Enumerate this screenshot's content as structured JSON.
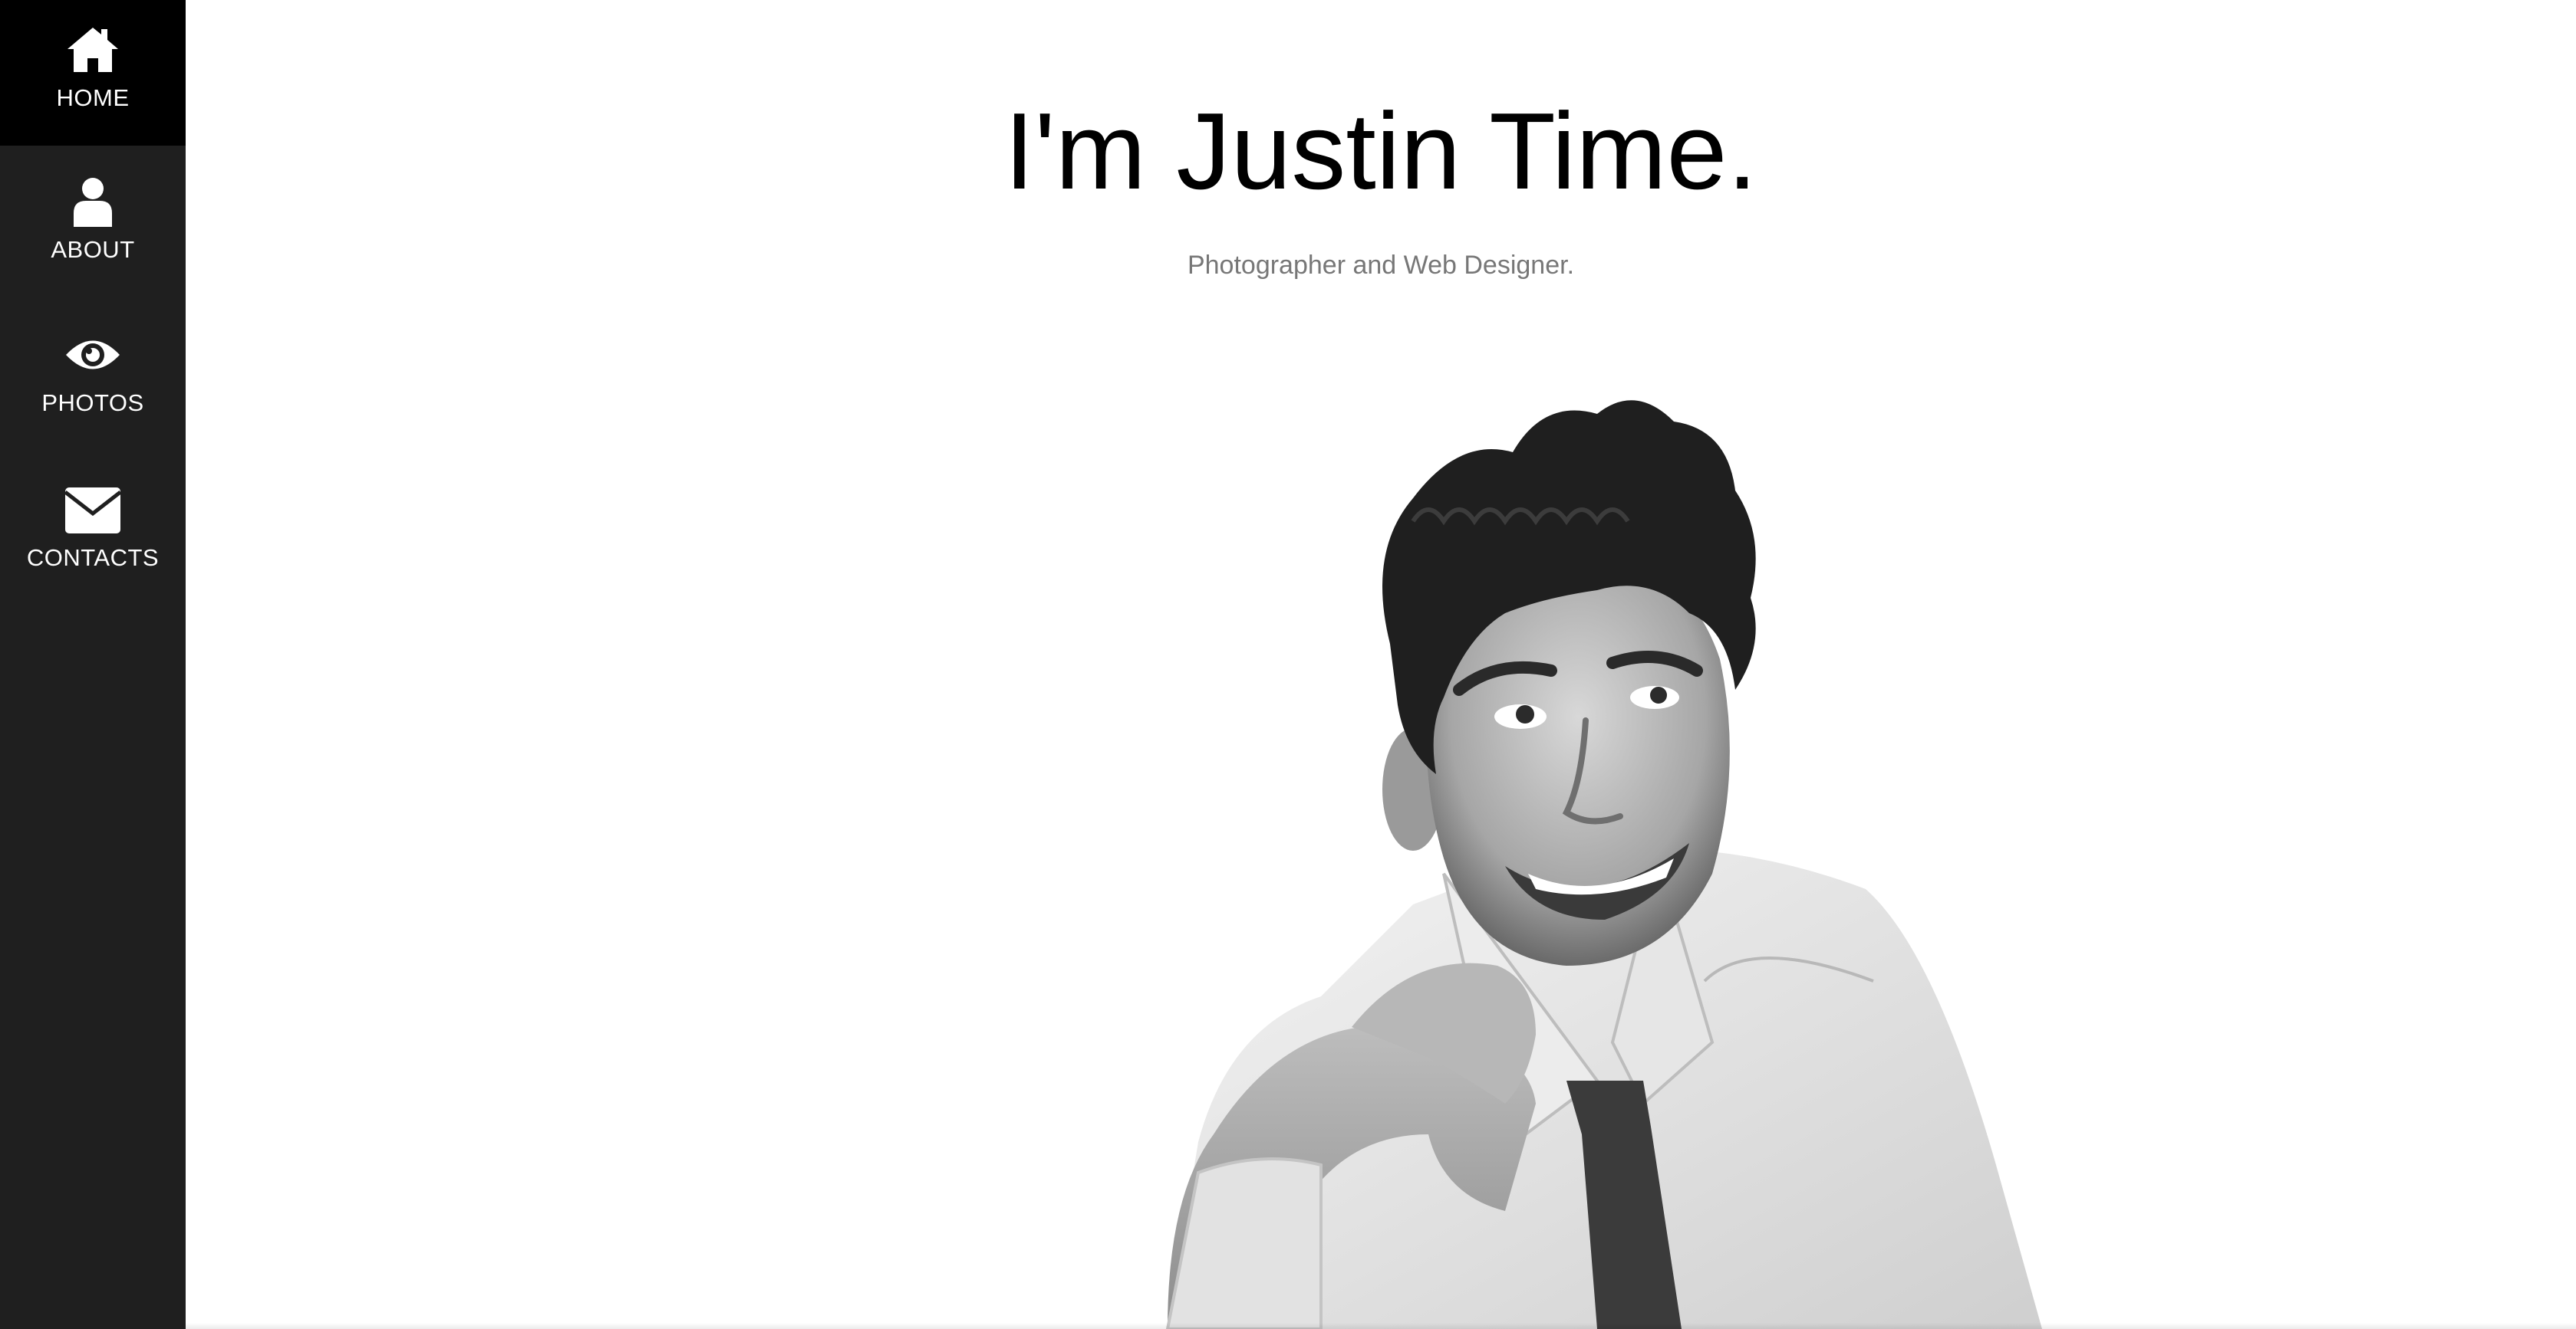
{
  "sidebar": {
    "items": [
      {
        "label": "HOME",
        "icon": "home-icon",
        "active": true
      },
      {
        "label": "ABOUT",
        "icon": "user-icon",
        "active": false
      },
      {
        "label": "PHOTOS",
        "icon": "eye-icon",
        "active": false
      },
      {
        "label": "CONTACTS",
        "icon": "envelope-icon",
        "active": false
      }
    ]
  },
  "hero": {
    "title": "I'm Justin Time.",
    "subtitle": "Photographer and Web Designer."
  },
  "colors": {
    "sidebar_bg": "#1f1f1f",
    "active_bg": "#000000",
    "text_light": "#ffffff",
    "subtitle": "#777777"
  }
}
